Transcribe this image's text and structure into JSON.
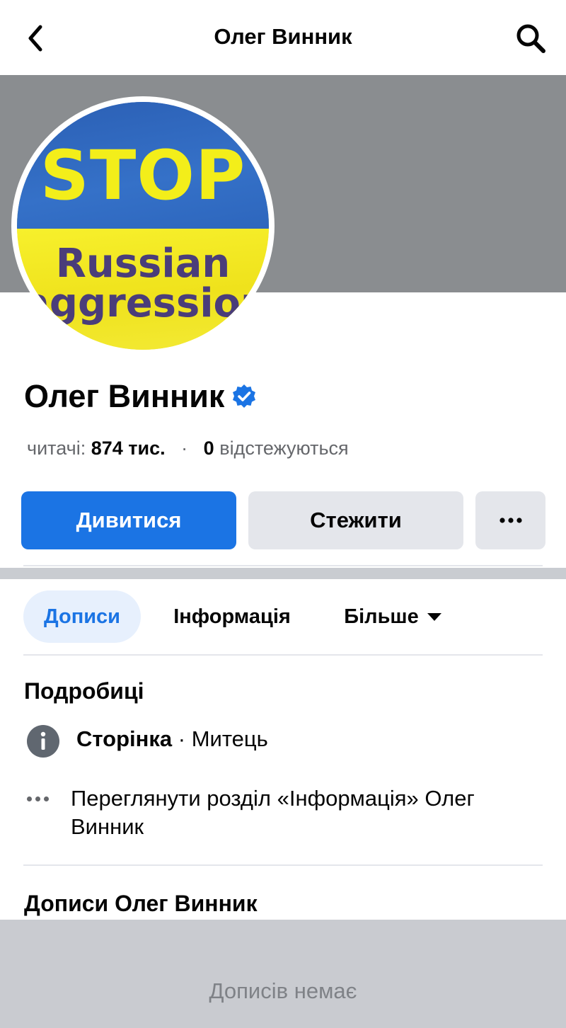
{
  "header": {
    "title": "Олег Винник",
    "back_icon": "chevron-left-icon",
    "search_icon": "search-icon"
  },
  "profile": {
    "avatar_text_top": "STOP",
    "avatar_text_line1": "Russian",
    "avatar_text_line2": "aggression",
    "name": "Олег Винник",
    "verified": true,
    "followers_label": "читачі:",
    "followers_value": "874 тис.",
    "separator": "·",
    "following_value": "0",
    "following_label": "відстежуються"
  },
  "actions": {
    "view_label": "Дивитися",
    "follow_label": "Стежити",
    "more_label": "···"
  },
  "tabs": [
    {
      "label": "Дописи",
      "active": true
    },
    {
      "label": "Інформація",
      "active": false
    },
    {
      "label": "Більше",
      "active": false
    }
  ],
  "details": {
    "heading": "Подробиці",
    "category_bold": "Сторінка",
    "category_rest": " · Митець",
    "see_about_line1": "Переглянути розділ «Інформація» Олег",
    "see_about_line2": "Винник"
  },
  "posts": {
    "heading": "Дописи Олег Винник",
    "empty_text": "Дописів немає"
  },
  "colors": {
    "accent": "#1b74e4",
    "cover": "#8a8d90",
    "button_grey": "#e4e6eb"
  }
}
